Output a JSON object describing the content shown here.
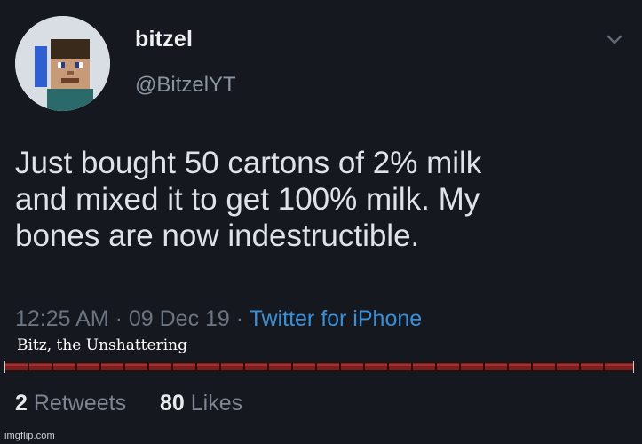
{
  "author": {
    "display_name": "bitzel",
    "handle": "@BitzelYT"
  },
  "tweet": {
    "text": "Just bought 50 cartons of 2% milk\nand mixed it to get 100% milk. My\nbones are now indestructible.",
    "time": "12:25 AM",
    "date": "09 Dec 19",
    "separator": "·",
    "source": "Twitter for iPhone"
  },
  "caption": "Bitz, the Unshattering",
  "stats": {
    "retweets_count": "2",
    "retweets_label": "Retweets",
    "likes_count": "80",
    "likes_label": "Likes"
  },
  "watermark": "imgflip.com",
  "icons": {
    "avatar": "pixel-character-avatar",
    "menu": "chevron-down-icon"
  },
  "colors": {
    "background": "#15181f",
    "link": "#3b8fd6",
    "divider": "#7a1e1e"
  }
}
